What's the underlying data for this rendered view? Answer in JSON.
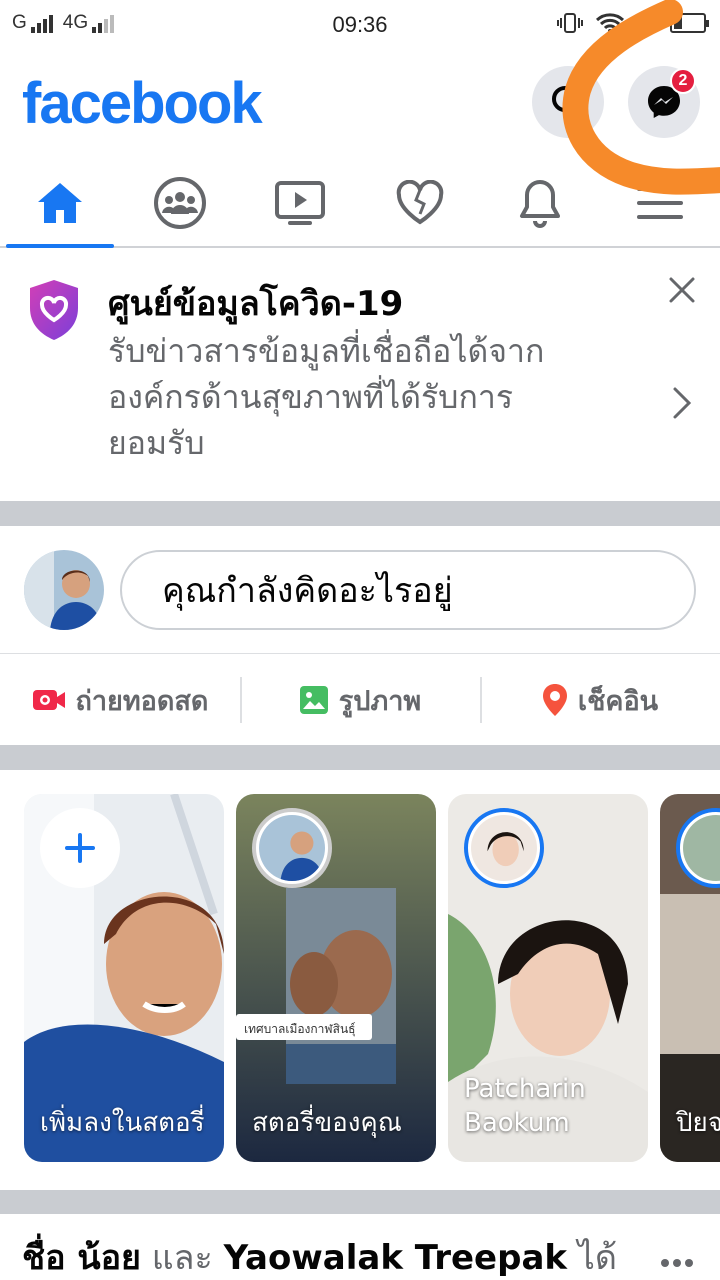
{
  "status_bar": {
    "carrier1": "G",
    "carrier2": "4G",
    "time": "09:36",
    "battery_text": "28"
  },
  "header": {
    "logo": "facebook",
    "messenger_badge": "2"
  },
  "tabs": [
    {
      "name": "home",
      "icon": "home-icon",
      "active": true
    },
    {
      "name": "groups",
      "icon": "groups-icon"
    },
    {
      "name": "watch",
      "icon": "video-icon"
    },
    {
      "name": "dating",
      "icon": "heart-icon"
    },
    {
      "name": "notifications",
      "icon": "bell-icon"
    },
    {
      "name": "menu",
      "icon": "hamburger-icon"
    }
  ],
  "covid": {
    "title": "ศูนย์ข้อมูลโควิด-19",
    "description": "รับข่าวสารข้อมูลที่เชื่อถือได้จากองค์กรด้านสุขภาพที่ได้รับการยอมรับ"
  },
  "composer": {
    "placeholder": "คุณกำลังคิดอะไรอยู่"
  },
  "actions": {
    "live": "ถ่ายทอดสด",
    "photo": "รูปภาพ",
    "checkin": "เช็คอิน"
  },
  "stories": {
    "add_label": "เพิ่มลงในสตอรี่",
    "your_story": "สตอรี่ของคุณ",
    "story_caption": "เทศบาลเมืองกาฬสินธุ์",
    "friend1": "Patcharin Baokum",
    "friend2": "ปิยจ จิตต"
  },
  "post": {
    "name1": "ชื่อ น้อย",
    "conj": " และ ",
    "name2": "Yaowalak Treepak",
    "suffix": " ได้"
  },
  "colors": {
    "brand": "#1877f2",
    "separator": "#c9ccd1",
    "badge": "#e41e3f",
    "scribble": "#f68a2a"
  }
}
